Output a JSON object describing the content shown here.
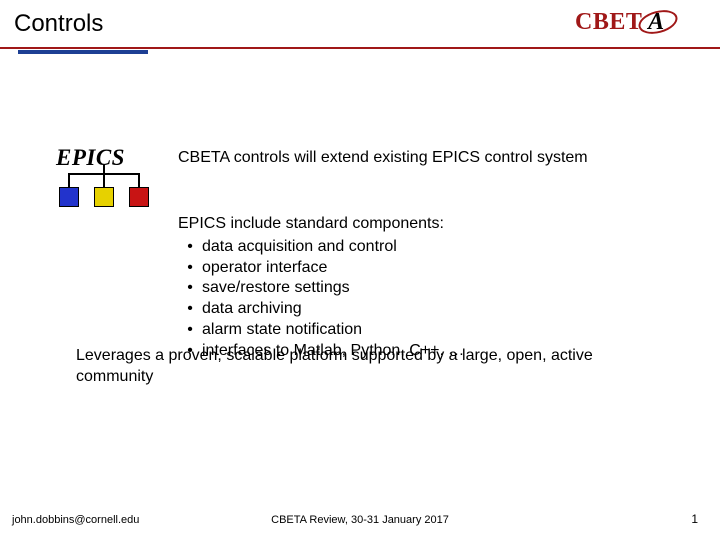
{
  "header": {
    "title": "Controls",
    "logo_text_prefix": "CBET",
    "logo_text_a": "A"
  },
  "epics_logo_text": "EPICS",
  "intro": "CBETA controls will extend existing EPICS control system",
  "components": {
    "heading": "EPICS include standard components:",
    "items": [
      "data acquisition and control",
      "operator interface",
      "save/restore settings",
      "data archiving",
      "alarm state notification",
      "interfaces to Matlab, Python, C++, …"
    ]
  },
  "leverage": "Leverages a proven, scalable platform supported by a large, open, active community",
  "footer": {
    "email": "john.dobbins@cornell.edu",
    "center": "CBETA Review, 30-31 January 2017",
    "page": "1"
  }
}
